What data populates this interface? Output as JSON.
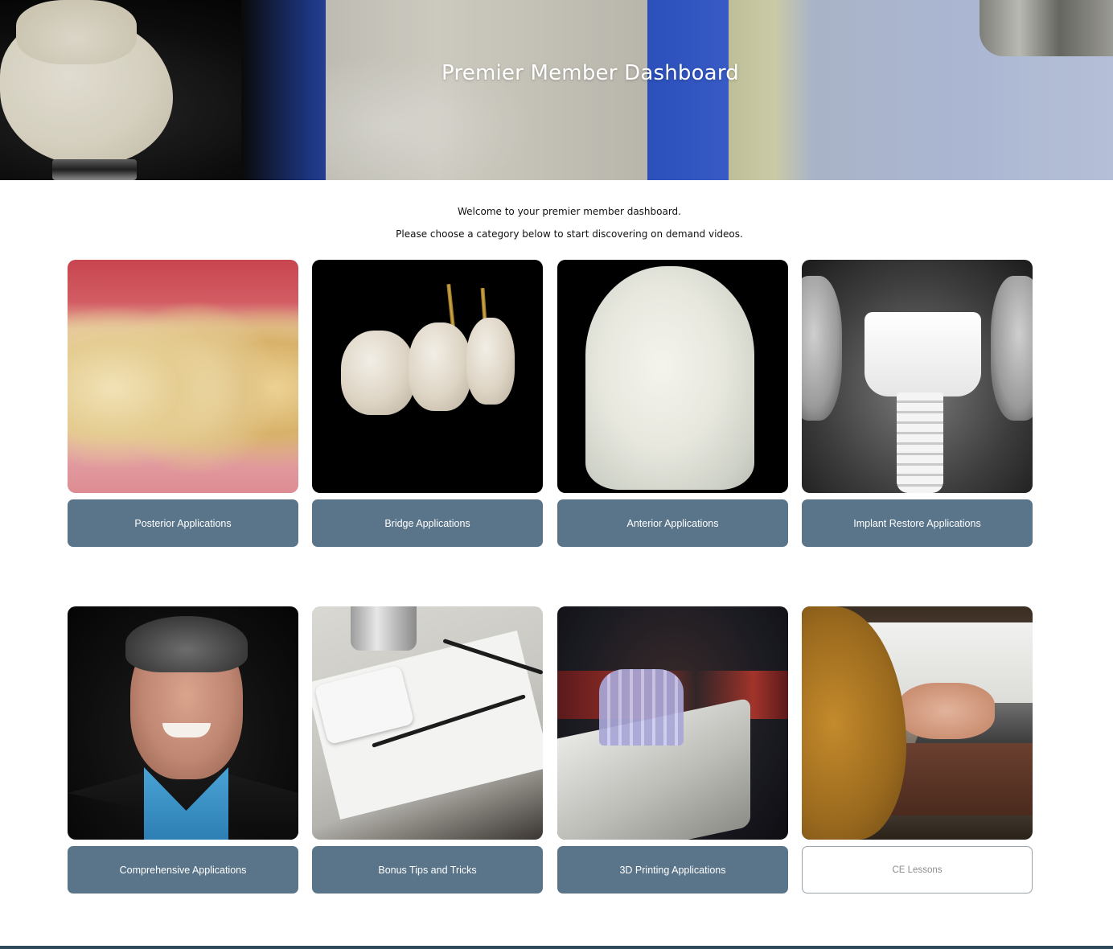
{
  "hero": {
    "title": "Premier Member Dashboard"
  },
  "intro": {
    "line1": "Welcome to your premier member dashboard.",
    "line2": "Please choose a category below to start discovering on demand videos."
  },
  "categories": [
    {
      "label": "Posterior Applications",
      "image": "posterior-teeth-photo"
    },
    {
      "label": "Bridge Applications",
      "image": "bridge-crowns-photo"
    },
    {
      "label": "Anterior Applications",
      "image": "anterior-tooth-photo"
    },
    {
      "label": "Implant Restore Applications",
      "image": "implant-xray-photo"
    },
    {
      "label": "Comprehensive Applications",
      "image": "presenter-portrait-photo"
    },
    {
      "label": "Bonus Tips and Tricks",
      "image": "palette-brushes-photo"
    },
    {
      "label": "3D Printing Applications",
      "image": "3d-printed-model-photo"
    },
    {
      "label": "CE Lessons",
      "image": "laptop-typing-photo",
      "style": "outline"
    }
  ],
  "colors": {
    "button": "#5a7589",
    "button_text": "#ffffff",
    "outline_border": "#9aa3aa",
    "footer_bar": "#2f4a5a"
  }
}
